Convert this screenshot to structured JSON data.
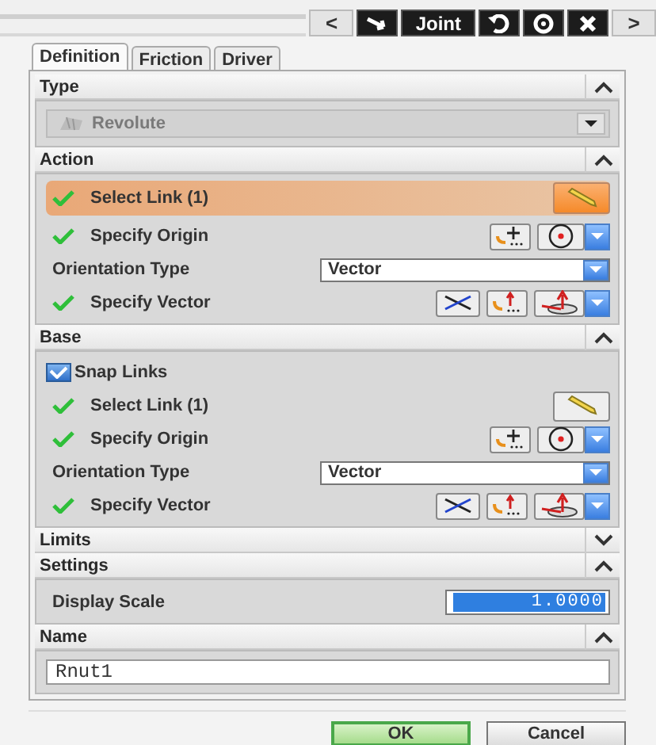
{
  "title_bar": {
    "prev": "<",
    "title": "Joint",
    "next": ">"
  },
  "tabs": [
    {
      "label": "Definition",
      "selected": true
    },
    {
      "label": "Friction",
      "selected": false
    },
    {
      "label": "Driver",
      "selected": false
    }
  ],
  "sections": [
    {
      "title": "Type",
      "expanded": true,
      "rows": [
        {
          "kind": "dropdown",
          "value": "Revolute",
          "disabled": true
        }
      ]
    },
    {
      "title": "Action",
      "expanded": true,
      "rows": [
        {
          "kind": "select",
          "label": "Select Link (1)",
          "done": true,
          "selected": true
        },
        {
          "kind": "origin",
          "label": "Specify Origin",
          "done": true
        },
        {
          "kind": "choice",
          "label": "Orientation Type",
          "value": "Vector"
        },
        {
          "kind": "vector",
          "label": "Specify Vector",
          "done": true
        }
      ]
    },
    {
      "title": "Base",
      "expanded": true,
      "rows": [
        {
          "kind": "checkbox",
          "label": "Snap Links",
          "checked": true
        },
        {
          "kind": "select",
          "label": "Select Link (1)",
          "done": true,
          "selected": false
        },
        {
          "kind": "origin",
          "label": "Specify Origin",
          "done": true
        },
        {
          "kind": "choice",
          "label": "Orientation Type",
          "value": "Vector"
        },
        {
          "kind": "vector",
          "label": "Specify Vector",
          "done": true
        }
      ]
    },
    {
      "title": "Limits",
      "expanded": false
    },
    {
      "title": "Settings",
      "expanded": true,
      "rows": [
        {
          "kind": "number",
          "label": "Display Scale",
          "value": "1.0000"
        }
      ]
    },
    {
      "title": "Name",
      "expanded": true,
      "rows": [
        {
          "kind": "text",
          "value": "Rnut1"
        }
      ]
    }
  ],
  "buttons": [
    {
      "label": "OK",
      "default": true
    },
    {
      "label": "Cancel",
      "default": false
    }
  ]
}
